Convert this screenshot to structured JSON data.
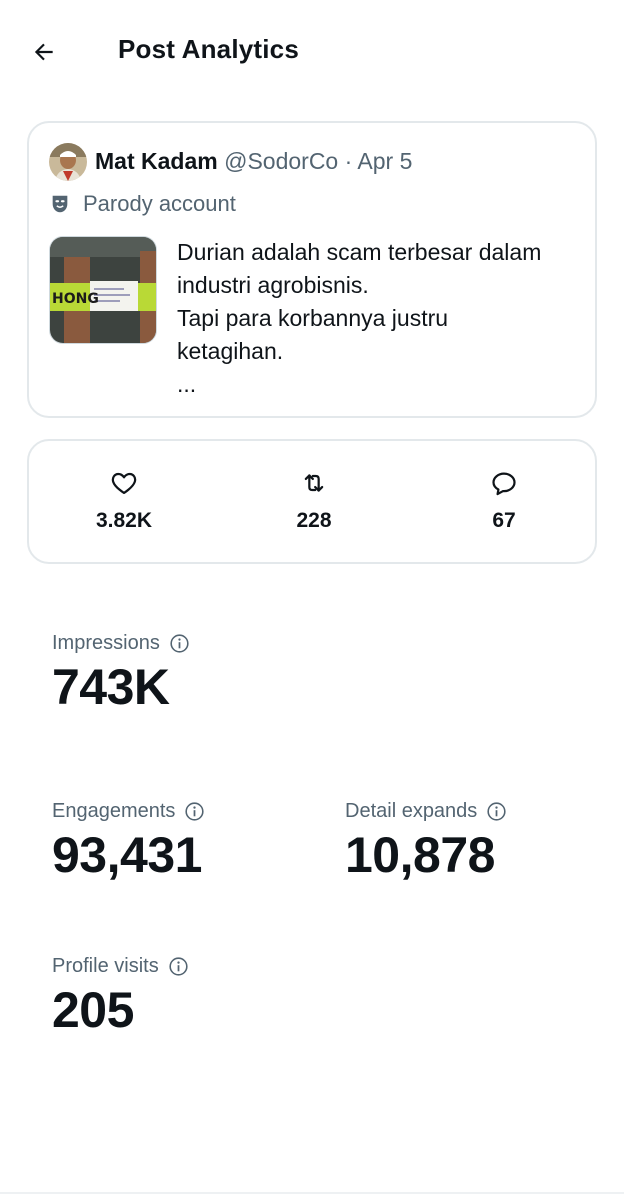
{
  "header": {
    "back_icon": "arrow-left-icon",
    "title": "Post Analytics"
  },
  "post": {
    "author_name": "Mat Kadam",
    "handle": "@SodorCo",
    "separator": "·",
    "date": "Apr 5",
    "parody_label": "Parody account",
    "parody_icon": "mask-icon",
    "text_lines": [
      "Durian adalah scam terbesar dalam",
      "industri agrobisnis.",
      "Tapi para korbannya justru",
      "ketagihan.",
      "..."
    ],
    "thumbnail_text": "HONG"
  },
  "stats": {
    "likes": {
      "icon": "heart-icon",
      "value": "3.82K"
    },
    "reposts": {
      "icon": "repost-icon",
      "value": "228"
    },
    "replies": {
      "icon": "reply-icon",
      "value": "67"
    }
  },
  "metrics": {
    "impressions": {
      "label": "Impressions",
      "value": "743K"
    },
    "engagements": {
      "label": "Engagements",
      "value": "93,431"
    },
    "detail_expands": {
      "label": "Detail expands",
      "value": "10,878"
    },
    "profile_visits": {
      "label": "Profile visits",
      "value": "205"
    }
  },
  "colors": {
    "text": "#0f1419",
    "muted": "#536471",
    "border": "#e3e8eb"
  }
}
